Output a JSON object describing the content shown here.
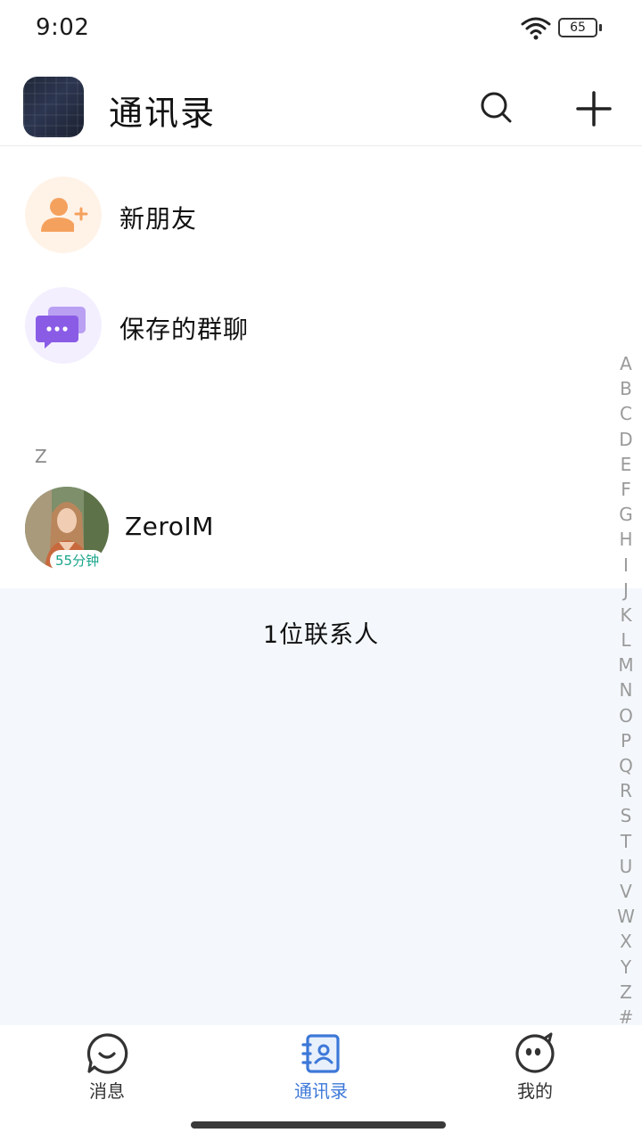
{
  "status_bar": {
    "time": "9:02",
    "battery": "65"
  },
  "header": {
    "title": "通讯录"
  },
  "function_items": [
    {
      "label": "新朋友",
      "icon": "add-friend-icon",
      "color": "#f5a15e",
      "bg": "#fff3e8"
    },
    {
      "label": "保存的群聊",
      "icon": "group-chat-icon",
      "color": "#8a5ce6",
      "bg": "#f3efff"
    }
  ],
  "contacts": {
    "section": "Z",
    "items": [
      {
        "name": "ZeroIM",
        "badge": "55分钟"
      }
    ]
  },
  "footer": {
    "count_text": "1位联系人"
  },
  "alphabet": [
    "A",
    "B",
    "C",
    "D",
    "E",
    "F",
    "G",
    "H",
    "I",
    "J",
    "K",
    "L",
    "M",
    "N",
    "O",
    "P",
    "Q",
    "R",
    "S",
    "T",
    "U",
    "V",
    "W",
    "X",
    "Y",
    "Z",
    "#"
  ],
  "bottom_nav": {
    "items": [
      {
        "label": "消息",
        "icon": "message-icon"
      },
      {
        "label": "通讯录",
        "icon": "contacts-icon",
        "active": true
      },
      {
        "label": "我的",
        "icon": "profile-icon"
      }
    ]
  },
  "colors": {
    "accent": "#3d78d8",
    "badge_text": "#1aa58c",
    "list_bg": "#f4f8fc"
  }
}
